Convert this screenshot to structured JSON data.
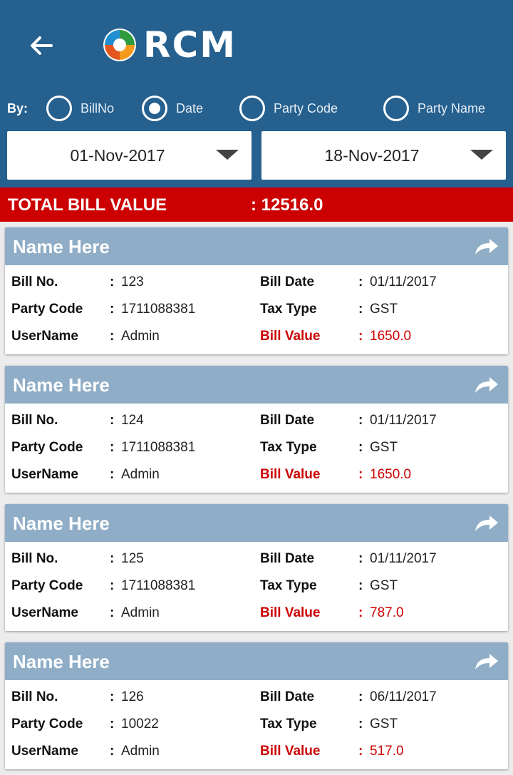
{
  "header": {
    "logo_text": "RCM",
    "by_label": "By:",
    "filters": [
      {
        "label": "BillNo",
        "selected": false
      },
      {
        "label": "Date",
        "selected": true
      },
      {
        "label": "Party Code",
        "selected": false
      },
      {
        "label": "Party Name",
        "selected": false
      }
    ],
    "from_date": "01-Nov-2017",
    "to_date": "18-Nov-2017"
  },
  "total": {
    "label": "TOTAL BILL VALUE",
    "value": ": 12516.0"
  },
  "field_labels": {
    "bill_no": "Bill No.",
    "party_code": "Party Code",
    "username": "UserName",
    "bill_date": "Bill Date",
    "tax_type": "Tax Type",
    "bill_value": "Bill Value",
    "colon": ":"
  },
  "bills": [
    {
      "name": "Name Here",
      "bill_no": "123",
      "party_code": "1711088381",
      "username": "Admin",
      "bill_date": "01/11/2017",
      "tax_type": "GST",
      "bill_value": "1650.0"
    },
    {
      "name": "Name Here",
      "bill_no": "124",
      "party_code": "1711088381",
      "username": "Admin",
      "bill_date": "01/11/2017",
      "tax_type": "GST",
      "bill_value": "1650.0"
    },
    {
      "name": "Name Here",
      "bill_no": "125",
      "party_code": "1711088381",
      "username": "Admin",
      "bill_date": "01/11/2017",
      "tax_type": "GST",
      "bill_value": "787.0"
    },
    {
      "name": "Name Here",
      "bill_no": "126",
      "party_code": "10022",
      "username": "Admin",
      "bill_date": "06/11/2017",
      "tax_type": "GST",
      "bill_value": "517.0"
    }
  ],
  "colors": {
    "header_bg": "#25608f",
    "total_bar": "#cc0000",
    "card_header": "#8fadc6",
    "bill_value_text": "#cc0000"
  }
}
